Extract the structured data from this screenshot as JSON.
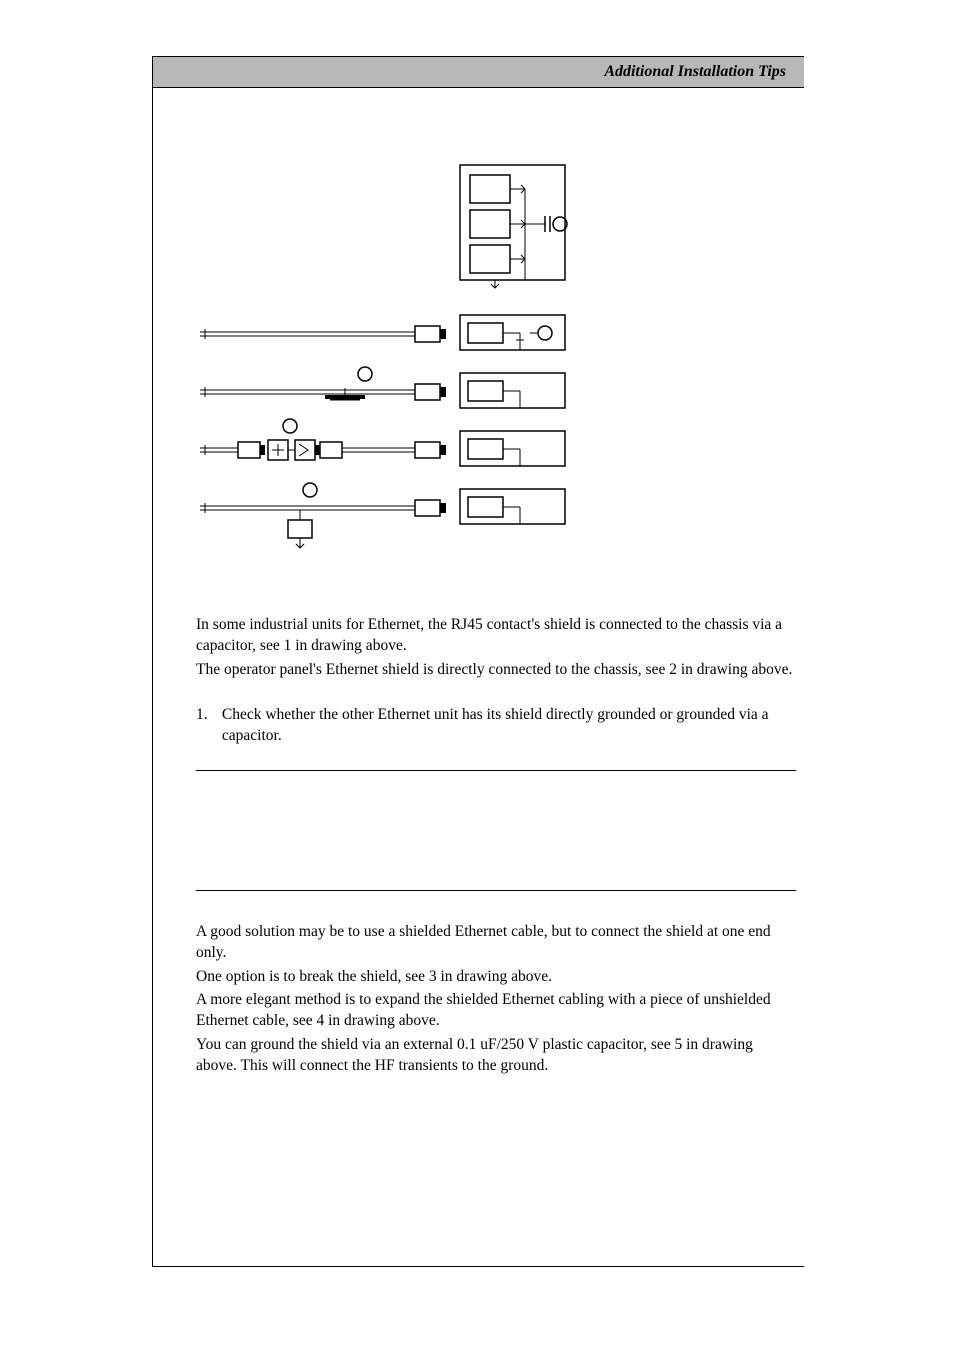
{
  "header": {
    "title": "Additional Installation Tips"
  },
  "paragraphs": {
    "p1": "In some industrial units for Ethernet, the RJ45 contact's shield is connected to the chassis via a capacitor, see 1 in drawing above.",
    "p2": "The operator panel's Ethernet shield is directly connected to the chassis, see 2 in drawing above.",
    "p3_num": "1.",
    "p3_text": "Check whether the other Ethernet unit has its shield directly grounded or grounded via a capacitor.",
    "p4": "A good solution may be to use a shielded Ethernet cable, but to connect the shield at one end only.",
    "p5": "One option is to break the shield, see 3 in drawing above.",
    "p6": "A more elegant method is to expand the shielded Ethernet cabling with a piece of unshielded Ethernet cable, see 4 in drawing above.",
    "p7": "You can ground the shield via an external 0.1 uF/250 V plastic capacitor, see 5 in drawing above.  This will connect the HF transients to the ground."
  },
  "chart_data": {
    "type": "diagram",
    "description": "Technical schematic showing 5 Ethernet cable shielding configurations numbered 1-5",
    "configurations": [
      {
        "id": 1,
        "description": "RJ45 shield to chassis via capacitor (top right group with capacitor symbol)"
      },
      {
        "id": 2,
        "description": "Operator panel Ethernet shield directly to chassis"
      },
      {
        "id": 3,
        "description": "Broken shield configuration"
      },
      {
        "id": 4,
        "description": "Shielded cable extended with unshielded segment"
      },
      {
        "id": 5,
        "description": "Shield grounded via external 0.1 uF/250 V plastic capacitor"
      }
    ]
  }
}
